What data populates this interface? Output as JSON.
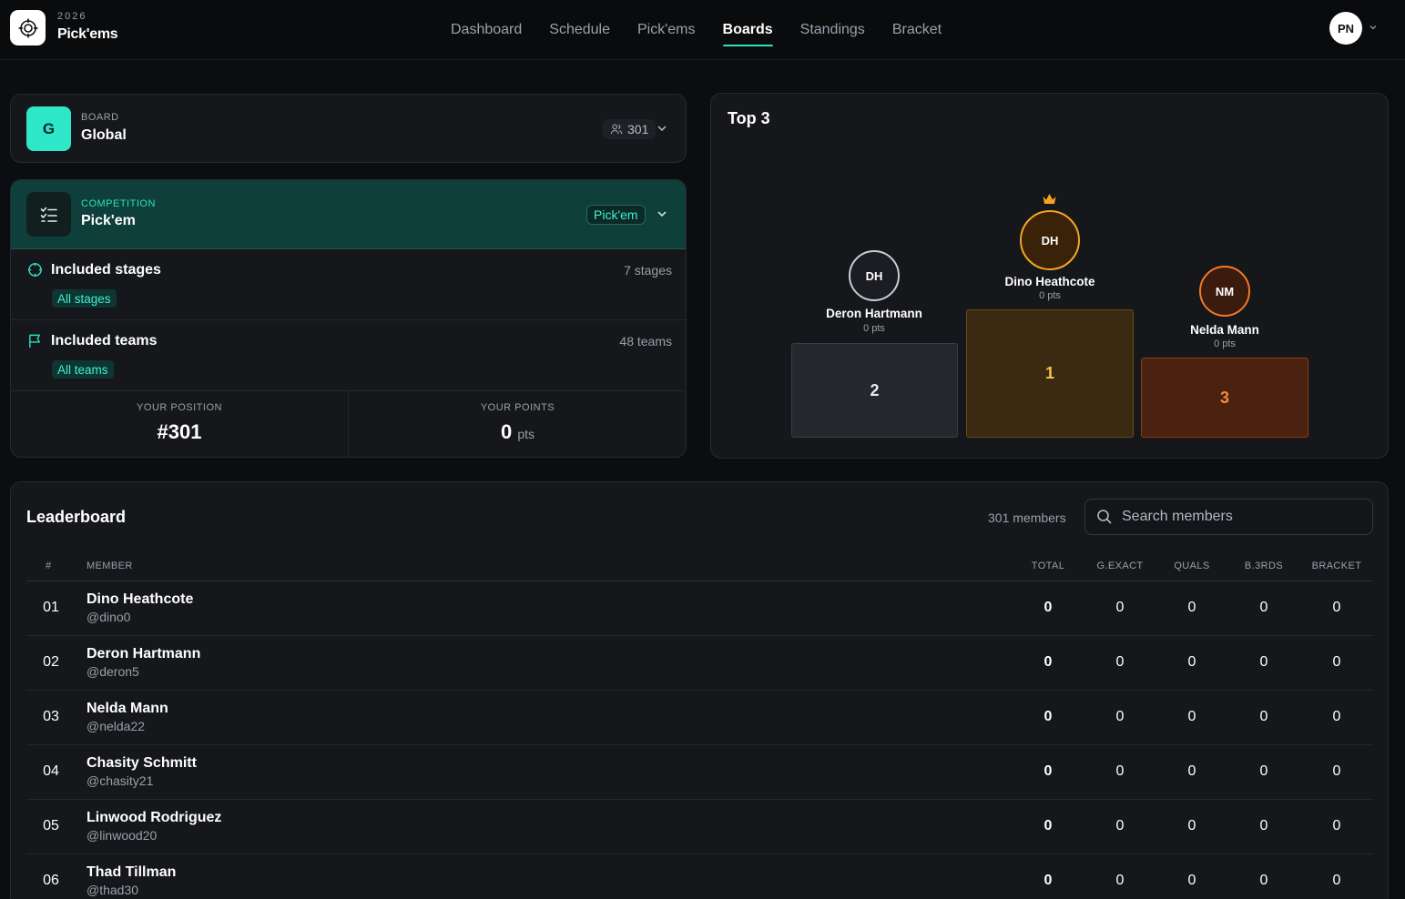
{
  "brand": {
    "year": "2026",
    "name": "Pick'ems"
  },
  "nav": [
    {
      "label": "Dashboard"
    },
    {
      "label": "Schedule"
    },
    {
      "label": "Pick'ems"
    },
    {
      "label": "Boards",
      "active": true
    },
    {
      "label": "Standings"
    },
    {
      "label": "Bracket"
    }
  ],
  "user": {
    "initials": "PN"
  },
  "board": {
    "section_label": "BOARD",
    "badge": "G",
    "name": "Global",
    "member_count": "301"
  },
  "competition": {
    "section_label": "COMPETITION",
    "name": "Pick'em",
    "type_pill": "Pick'em",
    "stages": {
      "title": "Included stages",
      "count": "7 stages",
      "chip": "All stages"
    },
    "teams": {
      "title": "Included teams",
      "count": "48 teams",
      "chip": "All teams"
    },
    "your_position": {
      "label": "YOUR POSITION",
      "value": "#301"
    },
    "your_points": {
      "label": "YOUR POINTS",
      "value": "0",
      "unit": "pts"
    }
  },
  "top3": {
    "title": "Top 3",
    "first": {
      "initials": "DH",
      "name": "Dino Heathcote",
      "pts": "0 pts",
      "place": "1"
    },
    "second": {
      "initials": "DH",
      "name": "Deron Hartmann",
      "pts": "0 pts",
      "place": "2"
    },
    "third": {
      "initials": "NM",
      "name": "Nelda Mann",
      "pts": "0 pts",
      "place": "3"
    }
  },
  "leaderboard": {
    "title": "Leaderboard",
    "member_count": "301 members",
    "search_placeholder": "Search members",
    "columns": [
      "#",
      "MEMBER",
      "TOTAL",
      "G.EXACT",
      "QUALS",
      "B.3RDS",
      "BRACKET"
    ],
    "rows": [
      {
        "rank": "01",
        "name": "Dino Heathcote",
        "handle": "@dino0",
        "total": "0",
        "gexact": "0",
        "quals": "0",
        "b3rds": "0",
        "bracket": "0"
      },
      {
        "rank": "02",
        "name": "Deron Hartmann",
        "handle": "@deron5",
        "total": "0",
        "gexact": "0",
        "quals": "0",
        "b3rds": "0",
        "bracket": "0"
      },
      {
        "rank": "03",
        "name": "Nelda Mann",
        "handle": "@nelda22",
        "total": "0",
        "gexact": "0",
        "quals": "0",
        "b3rds": "0",
        "bracket": "0"
      },
      {
        "rank": "04",
        "name": "Chasity Schmitt",
        "handle": "@chasity21",
        "total": "0",
        "gexact": "0",
        "quals": "0",
        "b3rds": "0",
        "bracket": "0"
      },
      {
        "rank": "05",
        "name": "Linwood Rodriguez",
        "handle": "@linwood20",
        "total": "0",
        "gexact": "0",
        "quals": "0",
        "b3rds": "0",
        "bracket": "0"
      },
      {
        "rank": "06",
        "name": "Thad Tillman",
        "handle": "@thad30",
        "total": "0",
        "gexact": "0",
        "quals": "0",
        "b3rds": "0",
        "bracket": "0"
      }
    ]
  },
  "colors": {
    "accent": "#2de0c2",
    "gold": "#f5a524",
    "bronze": "#f07a2a",
    "silver": "#c8ccd3"
  },
  "icons": [
    "crosshair-logo-icon",
    "users-icon",
    "chevron-down-icon",
    "checklist-icon",
    "target-icon",
    "flag-icon",
    "crown-icon",
    "search-icon"
  ]
}
